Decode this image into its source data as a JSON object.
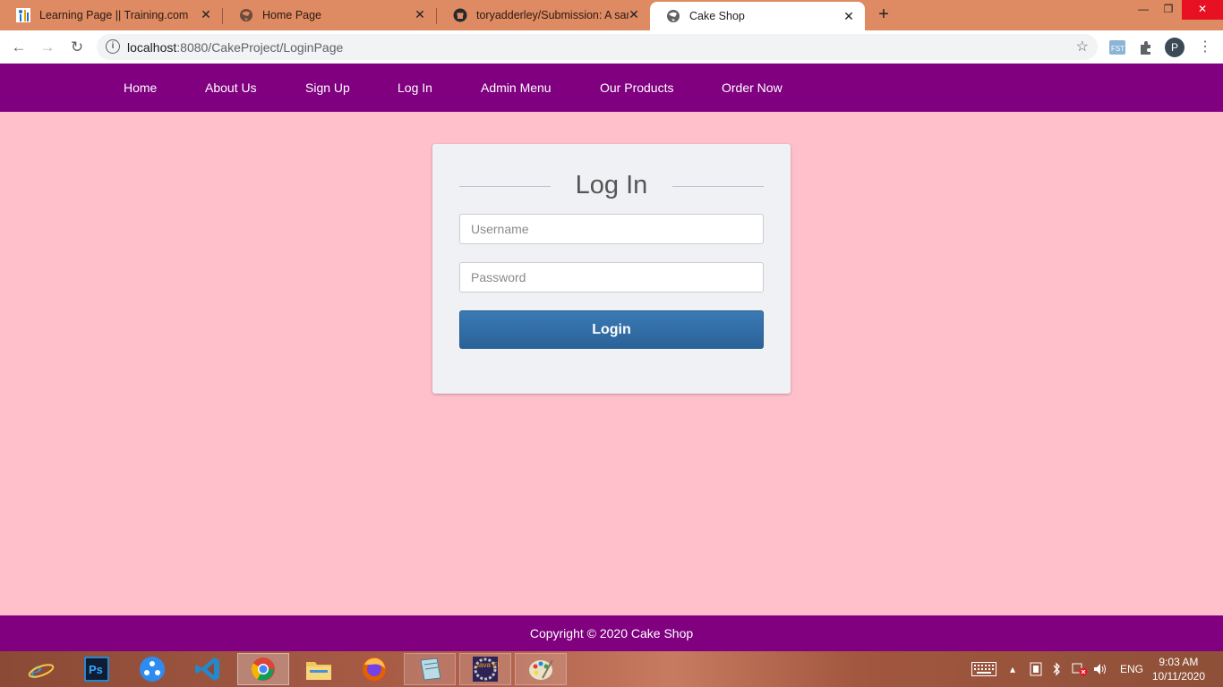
{
  "browser": {
    "tabs": [
      {
        "title": "Learning Page || Training.com",
        "icon": "training-favicon"
      },
      {
        "title": "Home Page",
        "icon": "globe-icon"
      },
      {
        "title": "toryadderley/Submission: A samp",
        "icon": "github-icon"
      },
      {
        "title": "Cake Shop",
        "icon": "globe-icon",
        "active": true
      }
    ],
    "address": {
      "host": "localhost",
      "rest": ":8080/CakeProject/LoginPage"
    },
    "profile_initial": "P"
  },
  "nav": {
    "items": [
      "Home",
      "About Us",
      "Sign Up",
      "Log In",
      "Admin Menu",
      "Our Products",
      "Order Now"
    ]
  },
  "login": {
    "title": "Log In",
    "username_placeholder": "Username",
    "password_placeholder": "Password",
    "button_label": "Login"
  },
  "footer": {
    "text": "Copyright © 2020 Cake Shop"
  },
  "taskbar": {
    "apps": [
      "internet-explorer",
      "photoshop",
      "sharing-app",
      "vs-code",
      "chrome",
      "file-explorer",
      "firefox",
      "notepad-app",
      "java-ee-ide",
      "paint"
    ],
    "java_label": "Java EE IDE",
    "language": "ENG",
    "time": "9:03 AM",
    "date": "10/11/2020"
  },
  "colors": {
    "nav_bg": "#800080",
    "page_bg": "#ffc0cb",
    "button": "#2a6298",
    "tab_strip": "#de8a63"
  }
}
